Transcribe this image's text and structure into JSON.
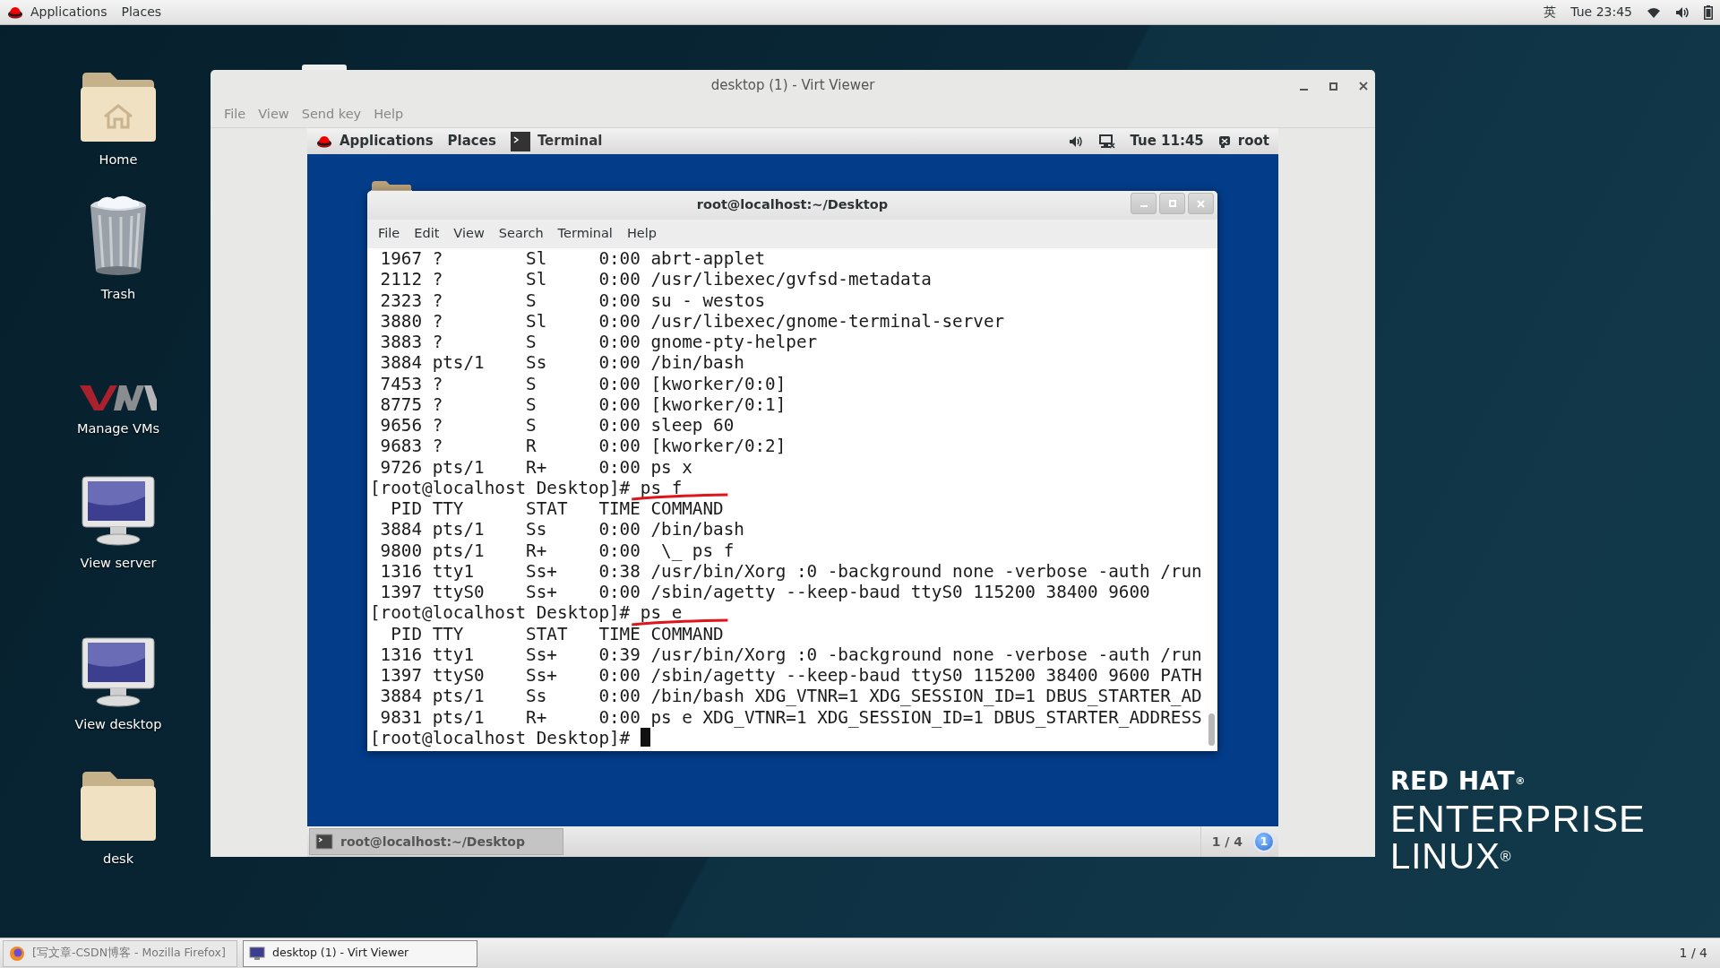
{
  "host_panel": {
    "menus": [
      "Applications",
      "Places"
    ],
    "input_method": "英",
    "clock": "Tue 23:45"
  },
  "desktop_icons": [
    {
      "label": "Home",
      "kind": "home"
    },
    {
      "label": "Trash",
      "kind": "trash"
    },
    {
      "label": "Manage VMs",
      "kind": "vm"
    },
    {
      "label": "View server",
      "kind": "monitor"
    },
    {
      "label": "View desktop",
      "kind": "monitor"
    },
    {
      "label": "desk",
      "kind": "folder"
    }
  ],
  "viewer_window": {
    "title": "desktop (1) - Virt Viewer",
    "menu": [
      "File",
      "View",
      "Send key",
      "Help"
    ],
    "guest": {
      "panel": {
        "menus": [
          "Applications",
          "Places"
        ],
        "task": "Terminal",
        "clock": "Tue 11:45",
        "user": "root"
      },
      "terminal": {
        "title": "root@localhost:~/Desktop",
        "menu": [
          "File",
          "Edit",
          "View",
          "Search",
          "Terminal",
          "Help"
        ],
        "lines": [
          {
            "kind": "output",
            "text": " 1967 ?        Sl     0:00 abrt-applet"
          },
          {
            "kind": "output",
            "text": " 2112 ?        Sl     0:00 /usr/libexec/gvfsd-metadata"
          },
          {
            "kind": "output",
            "text": " 2323 ?        S      0:00 su - westos"
          },
          {
            "kind": "output",
            "text": " 3880 ?        Sl     0:00 /usr/libexec/gnome-terminal-server"
          },
          {
            "kind": "output",
            "text": " 3883 ?        S      0:00 gnome-pty-helper"
          },
          {
            "kind": "output",
            "text": " 3884 pts/1    Ss     0:00 /bin/bash"
          },
          {
            "kind": "output",
            "text": " 7453 ?        S      0:00 [kworker/0:0]"
          },
          {
            "kind": "output",
            "text": " 8775 ?        S      0:00 [kworker/0:1]"
          },
          {
            "kind": "output",
            "text": " 9656 ?        S      0:00 sleep 60"
          },
          {
            "kind": "output",
            "text": " 9683 ?        R      0:00 [kworker/0:2]"
          },
          {
            "kind": "output",
            "text": " 9726 pts/1    R+     0:00 ps x"
          },
          {
            "kind": "prompt",
            "prompt": "[root@localhost Desktop]#",
            "command": "ps f",
            "underlined": true,
            "cursor": false
          },
          {
            "kind": "output",
            "text": "  PID TTY      STAT   TIME COMMAND"
          },
          {
            "kind": "output",
            "text": " 3884 pts/1    Ss     0:00 /bin/bash"
          },
          {
            "kind": "output",
            "text": " 9800 pts/1    R+     0:00  \\_ ps f"
          },
          {
            "kind": "output",
            "text": " 1316 tty1     Ss+    0:38 /usr/bin/Xorg :0 -background none -verbose -auth /run"
          },
          {
            "kind": "output",
            "text": " 1397 ttyS0    Ss+    0:00 /sbin/agetty --keep-baud ttyS0 115200 38400 9600"
          },
          {
            "kind": "prompt",
            "prompt": "[root@localhost Desktop]#",
            "command": "ps e",
            "underlined": true,
            "cursor": false
          },
          {
            "kind": "output",
            "text": "  PID TTY      STAT   TIME COMMAND"
          },
          {
            "kind": "output",
            "text": " 1316 tty1     Ss+    0:39 /usr/bin/Xorg :0 -background none -verbose -auth /run"
          },
          {
            "kind": "output",
            "text": " 1397 ttyS0    Ss+    0:00 /sbin/agetty --keep-baud ttyS0 115200 38400 9600 PATH"
          },
          {
            "kind": "output",
            "text": " 3884 pts/1    Ss     0:00 /bin/bash XDG_VTNR=1 XDG_SESSION_ID=1 DBUS_STARTER_AD"
          },
          {
            "kind": "output",
            "text": " 9831 pts/1    R+     0:00 ps e XDG_VTNR=1 XDG_SESSION_ID=1 DBUS_STARTER_ADDRESS"
          },
          {
            "kind": "prompt",
            "prompt": "[root@localhost Desktop]#",
            "underlined": false,
            "cursor": true
          }
        ]
      },
      "taskbar": {
        "items": [
          {
            "label": "root@localhost:~/Desktop",
            "selected": true
          }
        ],
        "workspace": "1 / 4",
        "notifications": "1"
      }
    }
  },
  "brand": {
    "name": "RED HAT$^{®}$",
    "product": "ENTERPRISE",
    "subproduct": "LINUX$^{®}$"
  },
  "taskbar": {
    "items": [
      {
        "label": "[写文章-CSDN博客 - Mozilla Firefox]",
        "kind": "browser",
        "selected": false
      },
      {
        "label": "desktop (1) - Virt Viewer",
        "kind": "viewer",
        "selected": true
      }
    ],
    "workspace": "1 / 4"
  }
}
